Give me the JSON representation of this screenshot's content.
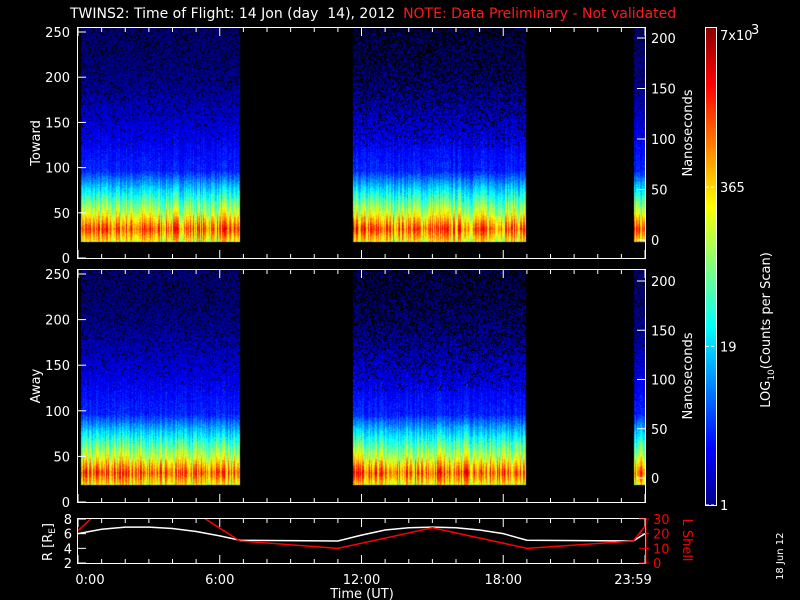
{
  "title": "TWINS2: Time of Flight: 14 Jon (day  14), 2012",
  "note": "NOTE: Data Preliminary - Not validated",
  "date_stamp": "18 Jun 12",
  "chart_data": {
    "type": "heatmap",
    "panels": [
      {
        "name": "Toward",
        "ylabel": "Toward",
        "yticks": [
          "0",
          "50",
          "100",
          "150",
          "200",
          "250"
        ],
        "ylim": [
          0,
          250
        ],
        "right_label": "Nanoseconds",
        "right_ticks": [
          "0",
          "50",
          "100",
          "150",
          "200"
        ]
      },
      {
        "name": "Away",
        "ylabel": "Away",
        "yticks": [
          "0",
          "50",
          "100",
          "150",
          "200",
          "250"
        ],
        "ylim": [
          0,
          250
        ],
        "right_label": "Nanoseconds",
        "right_ticks": [
          "0",
          "50",
          "100",
          "150",
          "200"
        ]
      }
    ],
    "data_intervals_hours": [
      [
        0.1,
        6.85
      ],
      [
        11.6,
        18.95
      ],
      [
        23.5,
        24
      ]
    ],
    "colorbar": {
      "label": "LOG10(Counts per Scan)",
      "label_main": "LOG",
      "label_sub": "10",
      "label_rest": "(Counts per Scan)",
      "min": 1,
      "max": 7000,
      "ticks": [
        "1",
        "19",
        "365"
      ],
      "top_label": "7x10",
      "top_sup": "3"
    },
    "orbit": {
      "ylabel": "R [R",
      "ylabel_sub": "E",
      "ylabel_end": "]",
      "ylim": [
        2,
        8
      ],
      "yticks": [
        "2",
        "4",
        "6",
        "8"
      ],
      "right_label": "L Shell",
      "right_ticks": [
        "0",
        "10",
        "20",
        "30"
      ],
      "right_lim": [
        0,
        30
      ],
      "hours": [
        0,
        1,
        2,
        3,
        4,
        5,
        6,
        6.85,
        11,
        12,
        13,
        14,
        15,
        16,
        17,
        18,
        19,
        23.5,
        24
      ],
      "R": [
        6,
        6.6,
        6.9,
        6.9,
        6.7,
        6.3,
        5.7,
        5.1,
        5.0,
        5.8,
        6.5,
        6.8,
        6.9,
        6.8,
        6.5,
        6.0,
        5.1,
        5.0,
        6.0
      ],
      "L_hours": [
        0,
        0.6,
        5.3,
        6.85,
        11,
        15,
        19,
        23.5,
        24
      ],
      "L": [
        22,
        31,
        31,
        15,
        10,
        24,
        10,
        15,
        25
      ]
    },
    "xlabel": "Time (UT)",
    "xticks": [
      "0:00",
      "6:00",
      "12:00",
      "18:00",
      "23:59"
    ],
    "xtick_hours": [
      0,
      6,
      12,
      18,
      24
    ]
  }
}
